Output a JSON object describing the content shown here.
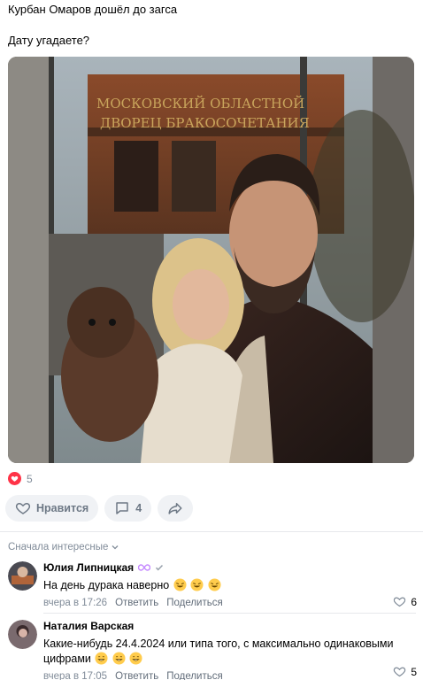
{
  "post": {
    "line1": "Курбан Омаров дошёл до загса",
    "line2": "Дату угадаете?",
    "photo": {
      "sign_line1": "МОСКОВСКИЙ ОБЛАСТНОЙ",
      "sign_line2": "ДВОРЕЦ БРАКОСОЧЕТАНИЯ"
    },
    "reactions_count": "5"
  },
  "actions": {
    "like_label": "Нравится",
    "comments_count": "4"
  },
  "comments_sort": "Сначала интересные",
  "comments": [
    {
      "author": "Юлия Липницкая",
      "text": "На день дурака наверно",
      "emojis": [
        "rofl-emoji",
        "rofl-emoji",
        "rofl-emoji"
      ],
      "time": "вчера в 17:26",
      "reply": "Ответить",
      "share": "Поделиться",
      "likes": "6"
    },
    {
      "author": "Наталия Варская",
      "text_line1": "Какие-нибудь 24.4.2024 или типа того, с максимально одинаковыми",
      "text_line2": "цифрами",
      "emojis": [
        "grin-emoji",
        "grin-emoji",
        "grin-emoji"
      ],
      "time": "вчера в 17:05",
      "reply": "Ответить",
      "share": "Поделиться",
      "likes": "5"
    }
  ],
  "colors": {
    "accent_red": "#ff3347",
    "muted": "#818c99",
    "pill_bg": "#f0f2f5"
  }
}
